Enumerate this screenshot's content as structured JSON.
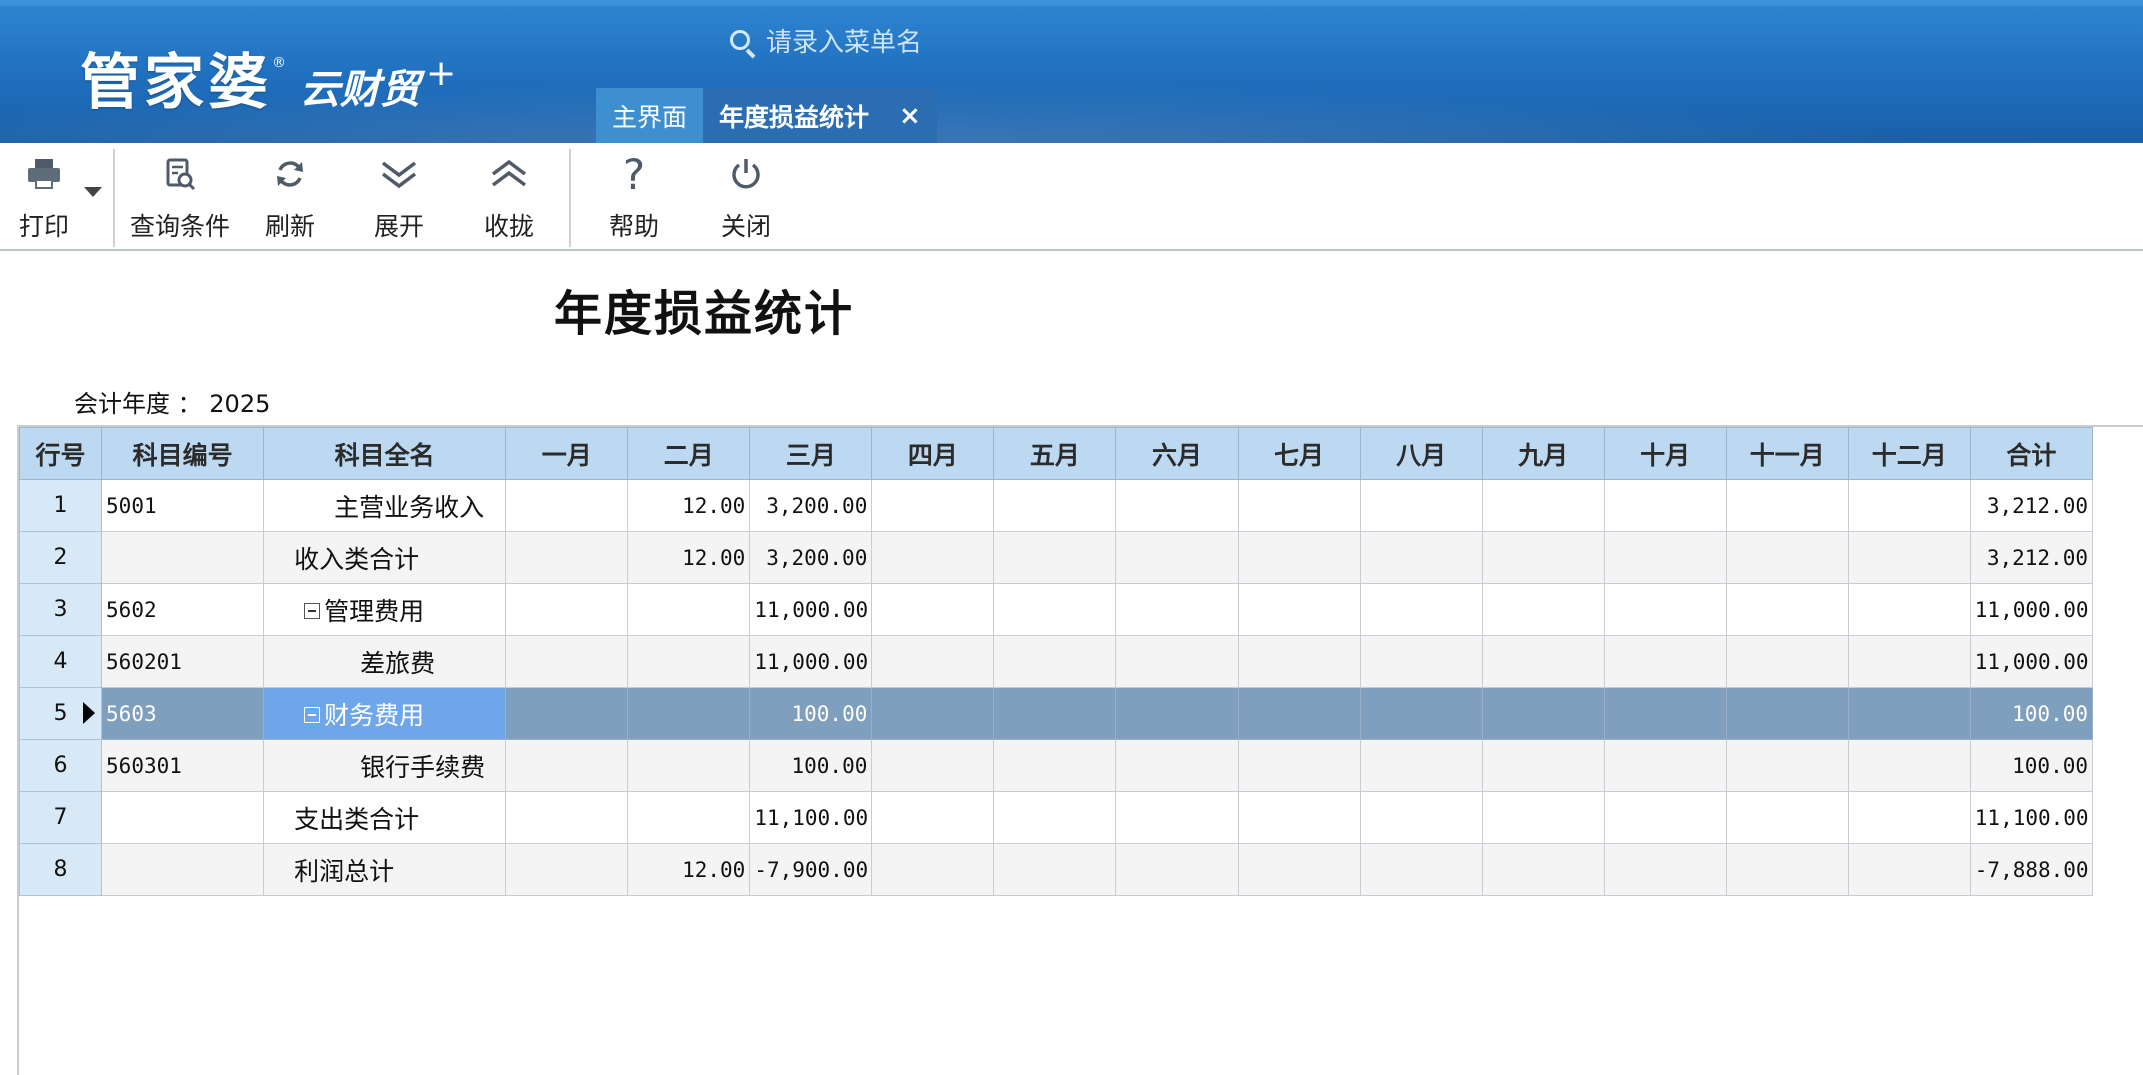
{
  "app": {
    "logo_main": "管家婆",
    "logo_sub": "云财贸",
    "logo_plus": "+",
    "logo_reg": "®"
  },
  "search": {
    "placeholder": "请录入菜单名"
  },
  "tabs": [
    {
      "label": "主界面"
    },
    {
      "label": "年度损益统计",
      "active": true,
      "close": "×"
    }
  ],
  "toolbar": {
    "print": "打印",
    "query": "查询条件",
    "refresh": "刷新",
    "expand": "展开",
    "collapse": "收拢",
    "help": "帮助",
    "close": "关闭"
  },
  "report": {
    "title": "年度损益统计",
    "fiscal_label": "会计年度 ：",
    "fiscal_year": "2025"
  },
  "table": {
    "columns": [
      "行号",
      "科目编号",
      "科目全名",
      "一月",
      "二月",
      "三月",
      "四月",
      "五月",
      "六月",
      "七月",
      "八月",
      "九月",
      "十月",
      "十一月",
      "十二月",
      "合计"
    ],
    "rows": [
      {
        "no": "1",
        "code": "5001",
        "name": "主营业务收入",
        "m1": "",
        "m2": "12.00",
        "m3": "3,200.00",
        "m4": "",
        "m5": "",
        "m6": "",
        "m7": "",
        "m8": "",
        "m9": "",
        "m10": "",
        "m11": "",
        "m12": "",
        "total": "3,212.00"
      },
      {
        "no": "2",
        "code": "",
        "name": "收入类合计",
        "m1": "",
        "m2": "12.00",
        "m3": "3,200.00",
        "m4": "",
        "m5": "",
        "m6": "",
        "m7": "",
        "m8": "",
        "m9": "",
        "m10": "",
        "m11": "",
        "m12": "",
        "total": "3,212.00"
      },
      {
        "no": "3",
        "code": "5602",
        "name": "管理费用",
        "m1": "",
        "m2": "",
        "m3": "11,000.00",
        "m4": "",
        "m5": "",
        "m6": "",
        "m7": "",
        "m8": "",
        "m9": "",
        "m10": "",
        "m11": "",
        "m12": "",
        "total": "11,000.00"
      },
      {
        "no": "4",
        "code": "560201",
        "name": "差旅费",
        "m1": "",
        "m2": "",
        "m3": "11,000.00",
        "m4": "",
        "m5": "",
        "m6": "",
        "m7": "",
        "m8": "",
        "m9": "",
        "m10": "",
        "m11": "",
        "m12": "",
        "total": "11,000.00"
      },
      {
        "no": "5",
        "code": "5603",
        "name": "财务费用",
        "m1": "",
        "m2": "",
        "m3": "100.00",
        "m4": "",
        "m5": "",
        "m6": "",
        "m7": "",
        "m8": "",
        "m9": "",
        "m10": "",
        "m11": "",
        "m12": "",
        "total": "100.00"
      },
      {
        "no": "6",
        "code": "560301",
        "name": "银行手续费",
        "m1": "",
        "m2": "",
        "m3": "100.00",
        "m4": "",
        "m5": "",
        "m6": "",
        "m7": "",
        "m8": "",
        "m9": "",
        "m10": "",
        "m11": "",
        "m12": "",
        "total": "100.00"
      },
      {
        "no": "7",
        "code": "",
        "name": "支出类合计",
        "m1": "",
        "m2": "",
        "m3": "11,100.00",
        "m4": "",
        "m5": "",
        "m6": "",
        "m7": "",
        "m8": "",
        "m9": "",
        "m10": "",
        "m11": "",
        "m12": "",
        "total": "11,100.00"
      },
      {
        "no": "8",
        "code": "",
        "name": "利润总计",
        "m1": "",
        "m2": "12.00",
        "m3": "-7,900.00",
        "m4": "",
        "m5": "",
        "m6": "",
        "m7": "",
        "m8": "",
        "m9": "",
        "m10": "",
        "m11": "",
        "m12": "",
        "total": "-7,888.00"
      }
    ]
  },
  "icons": {
    "print": "printer-icon",
    "query": "query-conditions-icon",
    "refresh": "refresh-icon",
    "expand": "expand-icon",
    "collapse": "collapse-icon",
    "help": "help-icon",
    "close": "power-icon"
  },
  "colors": {
    "header": "#1f6fbe",
    "active_tab": "#2a6db0",
    "grid_header": "#bcd9f1",
    "selected_row": "#7f9fbe",
    "selected_cell": "#6fa6ea"
  }
}
